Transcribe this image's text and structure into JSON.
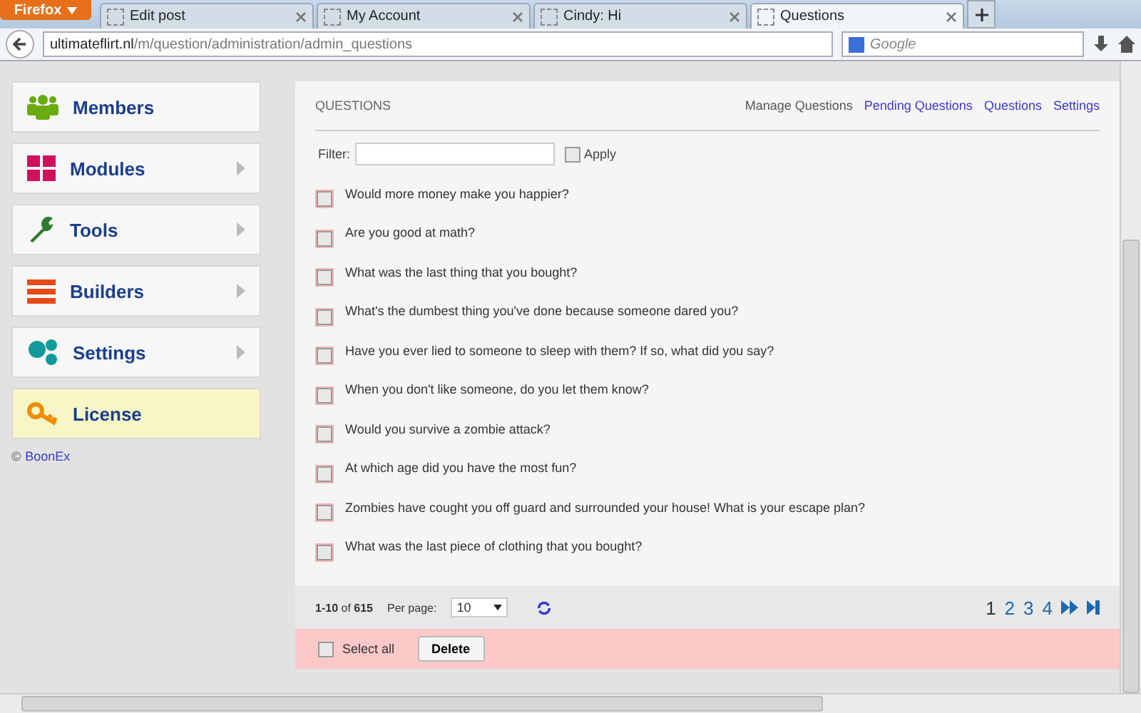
{
  "browser": {
    "menu_button": "Firefox",
    "tabs": [
      {
        "label": "Edit post",
        "selected": false
      },
      {
        "label": "My Account",
        "selected": false
      },
      {
        "label": "Cindy: Hi",
        "selected": false
      },
      {
        "label": "Questions",
        "selected": true
      }
    ],
    "url_host": "ultimateflirt.nl",
    "url_path": "/m/question/administration/admin_questions",
    "search_placeholder": "Google"
  },
  "sidebar": {
    "items": [
      {
        "label": "Members",
        "kind": "members",
        "arrow": false,
        "highlighted": false
      },
      {
        "label": "Modules",
        "kind": "modules",
        "arrow": true,
        "highlighted": false
      },
      {
        "label": "Tools",
        "kind": "tools",
        "arrow": true,
        "highlighted": false
      },
      {
        "label": "Builders",
        "kind": "builders",
        "arrow": true,
        "highlighted": false
      },
      {
        "label": "Settings",
        "kind": "settings",
        "arrow": true,
        "highlighted": false
      },
      {
        "label": "License",
        "kind": "license",
        "arrow": false,
        "highlighted": true
      }
    ],
    "copyright": "©",
    "copyright_link": "BoonEx"
  },
  "panel": {
    "title": "QUESTIONS",
    "links": [
      {
        "label": "Manage Questions",
        "selected": true
      },
      {
        "label": "Pending Questions",
        "selected": false
      },
      {
        "label": "Questions",
        "selected": false
      },
      {
        "label": "Settings",
        "selected": false
      }
    ],
    "filter_label": "Filter:",
    "apply_label": "Apply",
    "apply_checked": false,
    "questions": [
      {
        "text": "Would more money make you happier?",
        "checked": false
      },
      {
        "text": "Are you good at math?",
        "checked": false
      },
      {
        "text": "What was the last thing that you bought?",
        "checked": false
      },
      {
        "text": "What's the dumbest thing you've done because someone dared you?",
        "checked": false
      },
      {
        "text": "Have you ever lied to someone to sleep with them? If so, what did you say?",
        "checked": false
      },
      {
        "text": "When you don't like someone, do you let them know?",
        "checked": false
      },
      {
        "text": "Would you survive a zombie attack?",
        "checked": false
      },
      {
        "text": "At which age did you have the most fun?",
        "checked": false
      },
      {
        "text": "Zombies have cought you off guard and surrounded your house! What is your escape plan?",
        "checked": false
      },
      {
        "text": "What was the last piece of clothing that you bought?",
        "checked": false
      }
    ],
    "range": "**1-10** of **615**",
    "per_page_label": "Per page:",
    "per_page": "10",
    "pages": [
      {
        "label": "1",
        "selected": true
      },
      {
        "label": "2",
        "selected": false
      },
      {
        "label": "3",
        "selected": false
      },
      {
        "label": "4",
        "selected": false
      }
    ],
    "select_all_label": "Select all",
    "select_all_checked": false,
    "delete_label": "Delete"
  }
}
